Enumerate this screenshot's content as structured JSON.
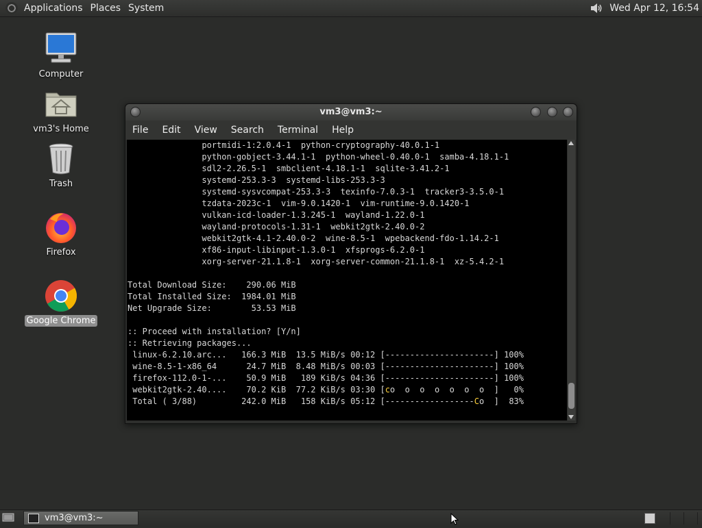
{
  "top_panel": {
    "menus": [
      "Applications",
      "Places",
      "System"
    ],
    "clock": "Wed Apr 12, 16:54"
  },
  "desktop": {
    "icons": [
      {
        "label": "Computer",
        "icon": "computer-icon"
      },
      {
        "label": "vm3's Home",
        "icon": "home-folder-icon"
      },
      {
        "label": "Trash",
        "icon": "trash-icon"
      },
      {
        "label": "Firefox",
        "icon": "firefox-icon"
      },
      {
        "label": "Google Chrome",
        "icon": "chrome-icon",
        "selected": true
      }
    ]
  },
  "terminal": {
    "title": "vm3@vm3:~",
    "menus": [
      "File",
      "Edit",
      "View",
      "Search",
      "Terminal",
      "Help"
    ],
    "lines": [
      "               portmidi-1:2.0.4-1  python-cryptography-40.0.1-1",
      "               python-gobject-3.44.1-1  python-wheel-0.40.0-1  samba-4.18.1-1",
      "               sdl2-2.26.5-1  smbclient-4.18.1-1  sqlite-3.41.2-1",
      "               systemd-253.3-3  systemd-libs-253.3-3",
      "               systemd-sysvcompat-253.3-3  texinfo-7.0.3-1  tracker3-3.5.0-1",
      "               tzdata-2023c-1  vim-9.0.1420-1  vim-runtime-9.0.1420-1",
      "               vulkan-icd-loader-1.3.245-1  wayland-1.22.0-1",
      "               wayland-protocols-1.31-1  webkit2gtk-2.40.0-2",
      "               webkit2gtk-4.1-2.40.0-2  wine-8.5-1  wpebackend-fdo-1.14.2-1",
      "               xf86-input-libinput-1.3.0-1  xfsprogs-6.2.0-1",
      "               xorg-server-21.1.8-1  xorg-server-common-21.1.8-1  xz-5.4.2-1",
      "",
      "Total Download Size:    290.06 MiB",
      "Total Installed Size:  1984.01 MiB",
      "Net Upgrade Size:        53.53 MiB",
      "",
      ":: Proceed with installation? [Y/n]",
      ":: Retrieving packages...",
      " linux-6.2.10.arc...   166.3 MiB  13.5 MiB/s 00:12 [----------------------] 100%",
      " wine-8.5-1-x86_64      24.7 MiB  8.48 MiB/s 00:03 [----------------------] 100%",
      " firefox-112.0-1-...    50.9 MiB   189 KiB/s 04:36 [----------------------] 100%"
    ],
    "progress_webkit": {
      "pre": " webkit2gtk-2.40....    70.2 KiB  77.2 KiB/s 03:30 [",
      "cursor": "c",
      "post": "o  o  o  o  o  o  o  ]   0%"
    },
    "progress_total": {
      "pre": " Total ( 3/88)         242.0 MiB   158 KiB/s 05:12 [------------------",
      "cursor": "C",
      "post": "o  ]  83%"
    }
  },
  "taskbar": {
    "task_label": "vm3@vm3:~"
  }
}
